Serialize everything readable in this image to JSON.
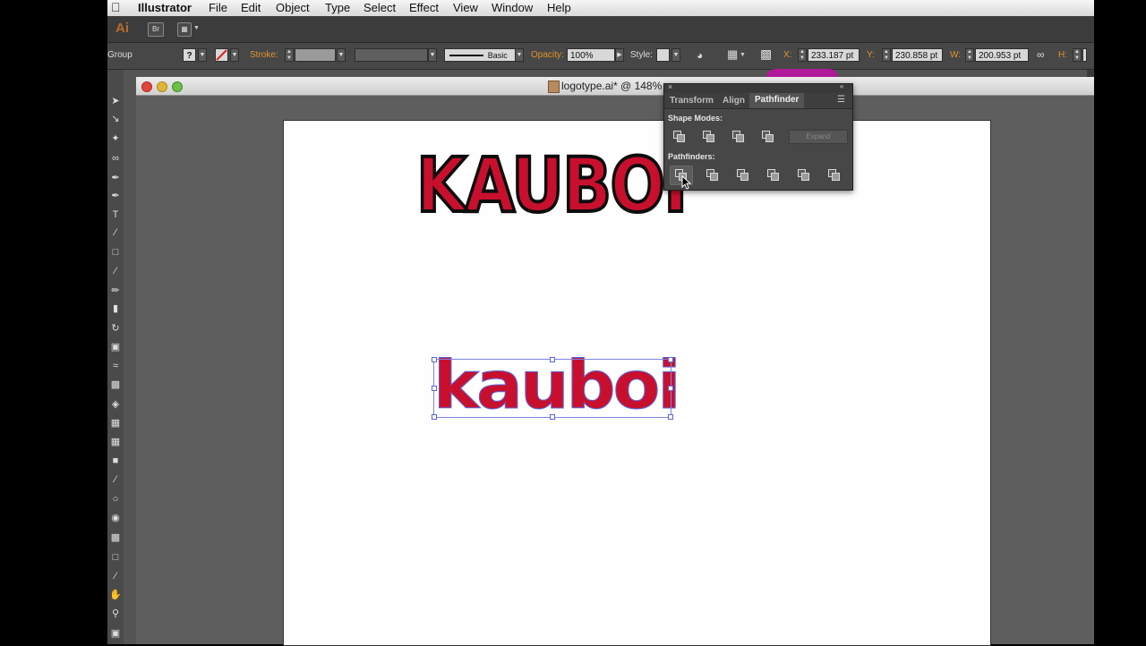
{
  "menubar": {
    "apple": "",
    "app_name": "Illustrator",
    "items": [
      "File",
      "Edit",
      "Object",
      "Type",
      "Select",
      "Effect",
      "View",
      "Window",
      "Help"
    ]
  },
  "appbar": {
    "logo": "Ai",
    "bridge": "Br"
  },
  "controlbar": {
    "selection_type": "Group",
    "fill_box": "?",
    "stroke_label": "Stroke:",
    "brush_label": "Basic",
    "opacity_label": "Opacity:",
    "opacity_value": "100%",
    "style_label": "Style:",
    "x_label": "X:",
    "x_value": "233.187 pt",
    "y_label": "Y:",
    "y_value": "230.858 pt",
    "w_label": "W:",
    "w_value": "200.953 pt",
    "h_label": "H:"
  },
  "document": {
    "title": "logotype.ai* @ 148%"
  },
  "panel": {
    "tabs": [
      "Transform",
      "Align",
      "Pathfinder"
    ],
    "active_tab": "Pathfinder",
    "shape_modes_label": "Shape Modes:",
    "expand_label": "Expand",
    "pathfinders_label": "Pathfinders:"
  },
  "artwork": {
    "top_logo": "KAUBOI",
    "bottom_logo": "kauboi"
  },
  "colors": {
    "logo_fill": "#c8102e",
    "logo_stroke": "#0d0d0d",
    "selection": "#5a64d8",
    "accent_orange": "#e2932b"
  }
}
